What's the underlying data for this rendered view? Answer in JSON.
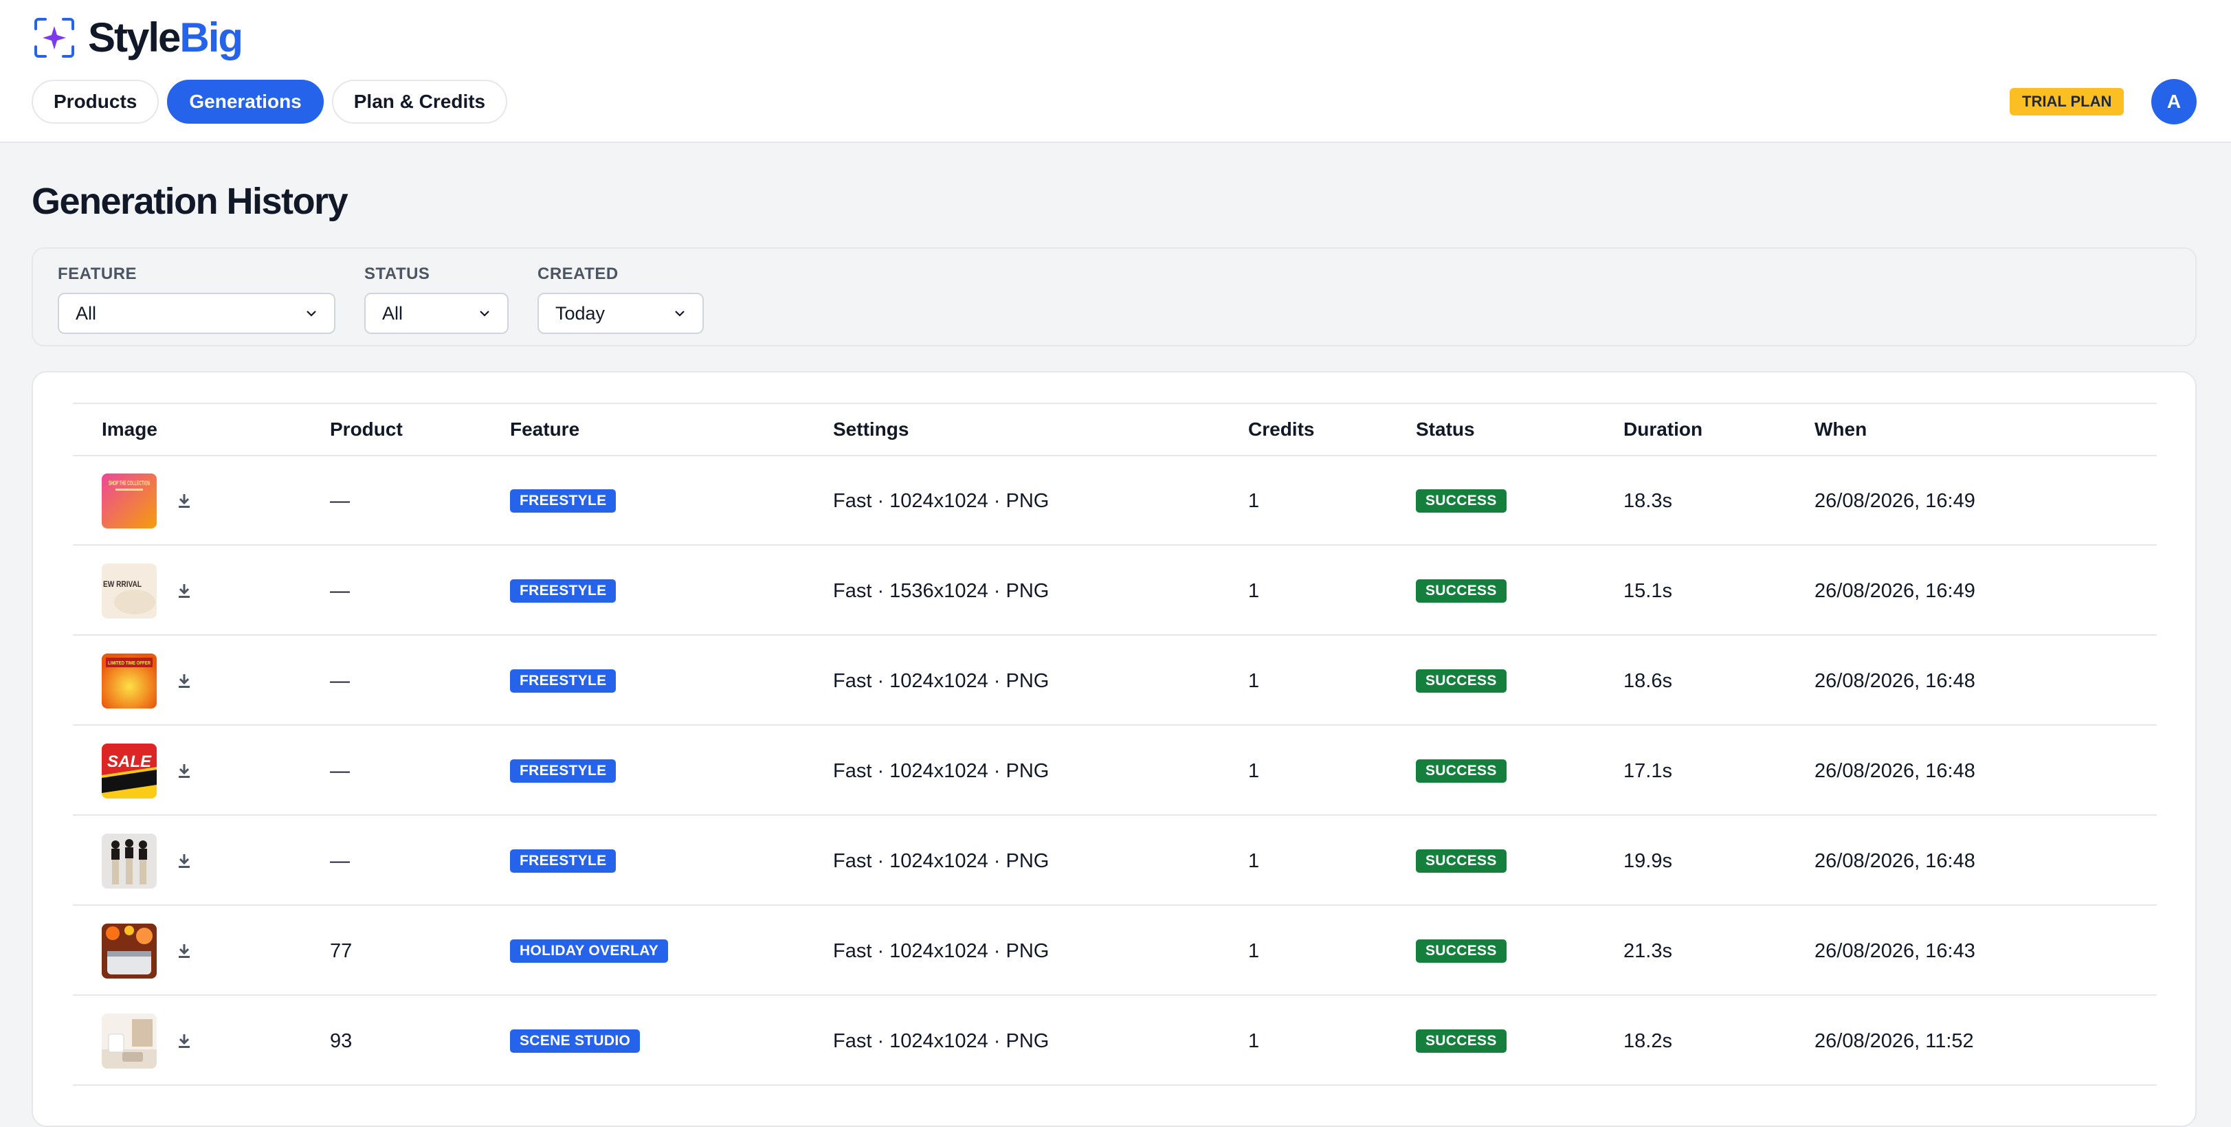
{
  "app": {
    "name_part1": "Style",
    "name_part2": "Big",
    "brand_color": "#2563eb"
  },
  "nav": {
    "tabs": [
      {
        "label": "Products",
        "active": false
      },
      {
        "label": "Generations",
        "active": true
      },
      {
        "label": "Plan & Credits",
        "active": false
      }
    ]
  },
  "account": {
    "plan_badge": "TRIAL PLAN",
    "avatar_initial": "A"
  },
  "page": {
    "title": "Generation History"
  },
  "filters": {
    "feature": {
      "label": "FEATURE",
      "value": "All"
    },
    "status": {
      "label": "STATUS",
      "value": "All"
    },
    "created": {
      "label": "CREATED",
      "value": "Today"
    }
  },
  "table": {
    "columns": [
      "Image",
      "Product",
      "Feature",
      "Settings",
      "Credits",
      "Status",
      "Duration",
      "When"
    ],
    "rows": [
      {
        "thumb": "shop-the-collection-pink",
        "thumb_text": "SHOP THE COLLECTION",
        "product": "—",
        "feature": "FREESTYLE",
        "settings": "Fast · 1024x1024 · PNG",
        "credits": "1",
        "status": "SUCCESS",
        "duration": "18.3s",
        "when": "26/08/2026, 16:49"
      },
      {
        "thumb": "new-arrival-cream",
        "thumb_text": "EW RRIVAL",
        "product": "—",
        "feature": "FREESTYLE",
        "settings": "Fast · 1536x1024 · PNG",
        "credits": "1",
        "status": "SUCCESS",
        "duration": "15.1s",
        "when": "26/08/2026, 16:49"
      },
      {
        "thumb": "limited-time-offer-orange",
        "thumb_text": "LIMITED TIME OFFER",
        "product": "—",
        "feature": "FREESTYLE",
        "settings": "Fast · 1024x1024 · PNG",
        "credits": "1",
        "status": "SUCCESS",
        "duration": "18.6s",
        "when": "26/08/2026, 16:48"
      },
      {
        "thumb": "sale-red-yellow",
        "thumb_text": "SALE",
        "product": "—",
        "feature": "FREESTYLE",
        "settings": "Fast · 1024x1024 · PNG",
        "credits": "1",
        "status": "SUCCESS",
        "duration": "17.1s",
        "when": "26/08/2026, 16:48"
      },
      {
        "thumb": "three-models-photo",
        "thumb_text": "",
        "product": "—",
        "feature": "FREESTYLE",
        "settings": "Fast · 1024x1024 · PNG",
        "credits": "1",
        "status": "SUCCESS",
        "duration": "19.9s",
        "when": "26/08/2026, 16:48"
      },
      {
        "thumb": "holiday-product-photo",
        "thumb_text": "",
        "product": "77",
        "feature": "HOLIDAY OVERLAY",
        "settings": "Fast · 1024x1024 · PNG",
        "credits": "1",
        "status": "SUCCESS",
        "duration": "21.3s",
        "when": "26/08/2026, 16:43"
      },
      {
        "thumb": "scene-studio-interior",
        "thumb_text": "",
        "product": "93",
        "feature": "SCENE STUDIO",
        "settings": "Fast · 1024x1024 · PNG",
        "credits": "1",
        "status": "SUCCESS",
        "duration": "18.2s",
        "when": "26/08/2026, 11:52"
      }
    ]
  },
  "colors": {
    "success": "#15803d",
    "feature_badge": "#2563eb",
    "trial_badge": "#fbbf24"
  }
}
